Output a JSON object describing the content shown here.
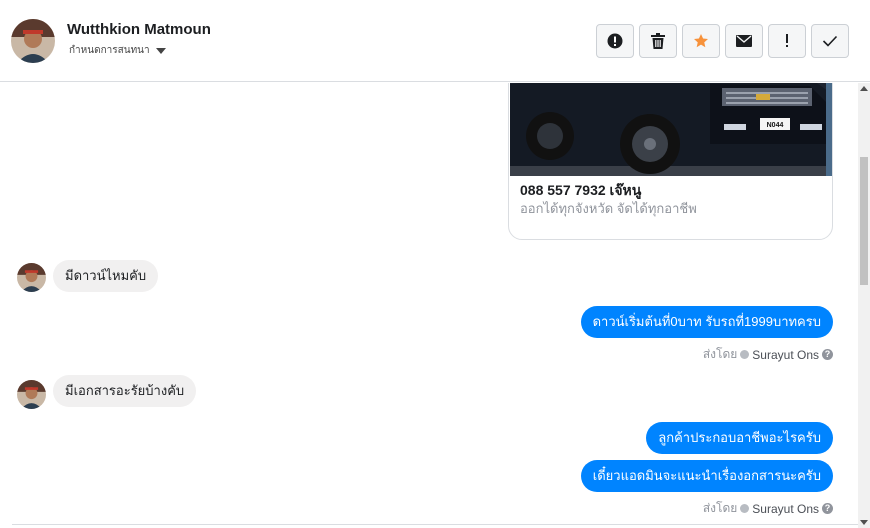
{
  "header": {
    "name": "Wutthkion Matmoun",
    "dropdown_label": "กำหนดการสนทนา"
  },
  "toolbar": {
    "buttons": [
      {
        "icon": "alert-circle-icon"
      },
      {
        "icon": "trash-icon"
      },
      {
        "icon": "star-icon",
        "color": "#f7923b"
      },
      {
        "icon": "envelope-icon"
      },
      {
        "icon": "exclamation-icon"
      },
      {
        "icon": "check-icon"
      }
    ]
  },
  "card": {
    "title": "088 557 7932 เจ๊หนู",
    "subtitle": "ออกได้ทุกจังหวัด จัดได้ทุกอาชีพ",
    "plate": "N044"
  },
  "messages": {
    "in_1": "มีดาวน์ไหมคับ",
    "out_1": "ดาวน์เริ่มต้นที่0บาท รับรถที่1999บาทครบ",
    "in_2": "มีเอกสารอะรัยบ้างคับ",
    "out_2": "ลูกค้าประกอบอาชีพอะไรครับ",
    "out_3": "เดี๋ยวแอดมินจะแนะนำเรื่องอกสารนะครับ"
  },
  "sent_by": {
    "label": "ส่งโดย",
    "name": "Surayut Ons"
  },
  "colors": {
    "accent": "#0084ff",
    "star": "#f7923b"
  }
}
